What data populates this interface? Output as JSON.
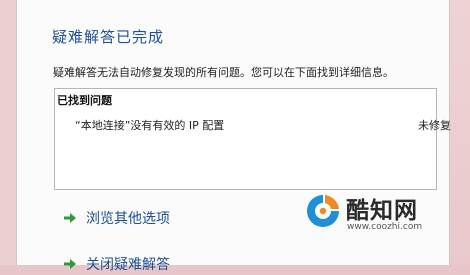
{
  "dialog": {
    "title": "疑难解答已完成",
    "description": "疑难解答无法自动修复发现的所有问题。您可以在下面找到详细信息。",
    "results": {
      "header": "已找到问题",
      "problems": [
        {
          "text": "“本地连接”没有有效的 IP 配置",
          "status": "未修复"
        }
      ]
    },
    "links": [
      {
        "label": "浏览其他选项",
        "icon": "green-arrow-icon"
      },
      {
        "label": "关闭疑难解答",
        "icon": "green-arrow-icon"
      }
    ]
  },
  "watermark": {
    "name": "酷知网",
    "url": "www.coozhi.com",
    "colors": {
      "blue": "#1f8fd6",
      "orange": "#f08a24"
    }
  },
  "colors": {
    "title": "#1f4e9e",
    "link": "#1d4f9a",
    "arrow": "#2e9b3a",
    "background": "#e6c6c8"
  }
}
